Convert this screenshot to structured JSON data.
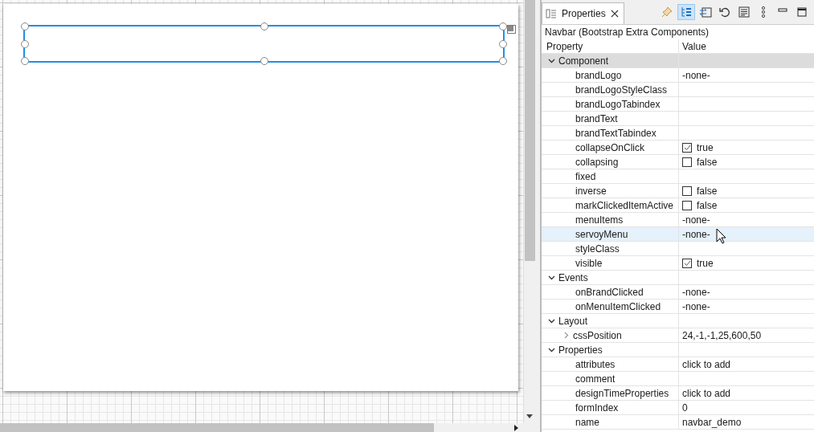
{
  "view": {
    "tab": {
      "title": "Properties",
      "selected": true
    },
    "toolbar": [
      {
        "kind": "pin",
        "pressed": false
      },
      {
        "kind": "tree",
        "pressed": true
      },
      {
        "kind": "link",
        "pressed": false
      },
      {
        "kind": "undo",
        "pressed": false
      },
      {
        "kind": "doc",
        "pressed": false
      },
      {
        "kind": "kebab",
        "pressed": false
      },
      {
        "kind": "minimize",
        "pressed": false
      },
      {
        "kind": "maximize",
        "pressed": false
      }
    ]
  },
  "subtitle": "Navbar (Bootstrap Extra Components)",
  "table": {
    "columns": [
      "Property",
      "Value"
    ],
    "groups": [
      {
        "label": "Component",
        "expanded": true,
        "selected": true,
        "children": [
          {
            "name": "brandLogo",
            "kind": "text",
            "value": "-none-"
          },
          {
            "name": "brandLogoStyleClass",
            "kind": "text"
          },
          {
            "name": "brandLogoTabindex",
            "kind": "text"
          },
          {
            "name": "brandText",
            "kind": "text"
          },
          {
            "name": "brandTextTabindex",
            "kind": "text"
          },
          {
            "name": "collapseOnClick",
            "kind": "checkbox",
            "checked": true,
            "value": "true"
          },
          {
            "name": "collapsing",
            "kind": "checkbox",
            "checked": false,
            "value": "false"
          },
          {
            "name": "fixed",
            "kind": "text"
          },
          {
            "name": "inverse",
            "kind": "checkbox",
            "checked": false,
            "value": "false"
          },
          {
            "name": "markClickedItemActive",
            "kind": "checkbox",
            "checked": false,
            "value": "false"
          },
          {
            "name": "menuItems",
            "kind": "text",
            "value": "-none-"
          },
          {
            "name": "servoyMenu",
            "kind": "text",
            "value": "-none-",
            "hovered": true
          },
          {
            "name": "styleClass",
            "kind": "text"
          },
          {
            "name": "visible",
            "kind": "checkbox",
            "checked": true,
            "value": "true"
          }
        ]
      },
      {
        "label": "Events",
        "expanded": true,
        "selected": false,
        "children": [
          {
            "name": "onBrandClicked",
            "kind": "text",
            "value": "-none-"
          },
          {
            "name": "onMenuItemClicked",
            "kind": "text",
            "value": "-none-"
          }
        ]
      },
      {
        "label": "Layout",
        "expanded": true,
        "selected": false,
        "children": [
          {
            "name": "cssPosition",
            "kind": "text",
            "value": "24,-1,-1,25,600,50",
            "expanded": false
          }
        ]
      },
      {
        "label": "Properties",
        "expanded": true,
        "selected": false,
        "children": [
          {
            "name": "attributes",
            "kind": "text",
            "value": "click to add"
          },
          {
            "name": "comment",
            "kind": "text"
          },
          {
            "name": "designTimeProperties",
            "kind": "text",
            "value": "click to add"
          },
          {
            "name": "formIndex",
            "kind": "text",
            "value": "0"
          },
          {
            "name": "name",
            "kind": "text",
            "value": "navbar_demo"
          }
        ]
      }
    ]
  }
}
